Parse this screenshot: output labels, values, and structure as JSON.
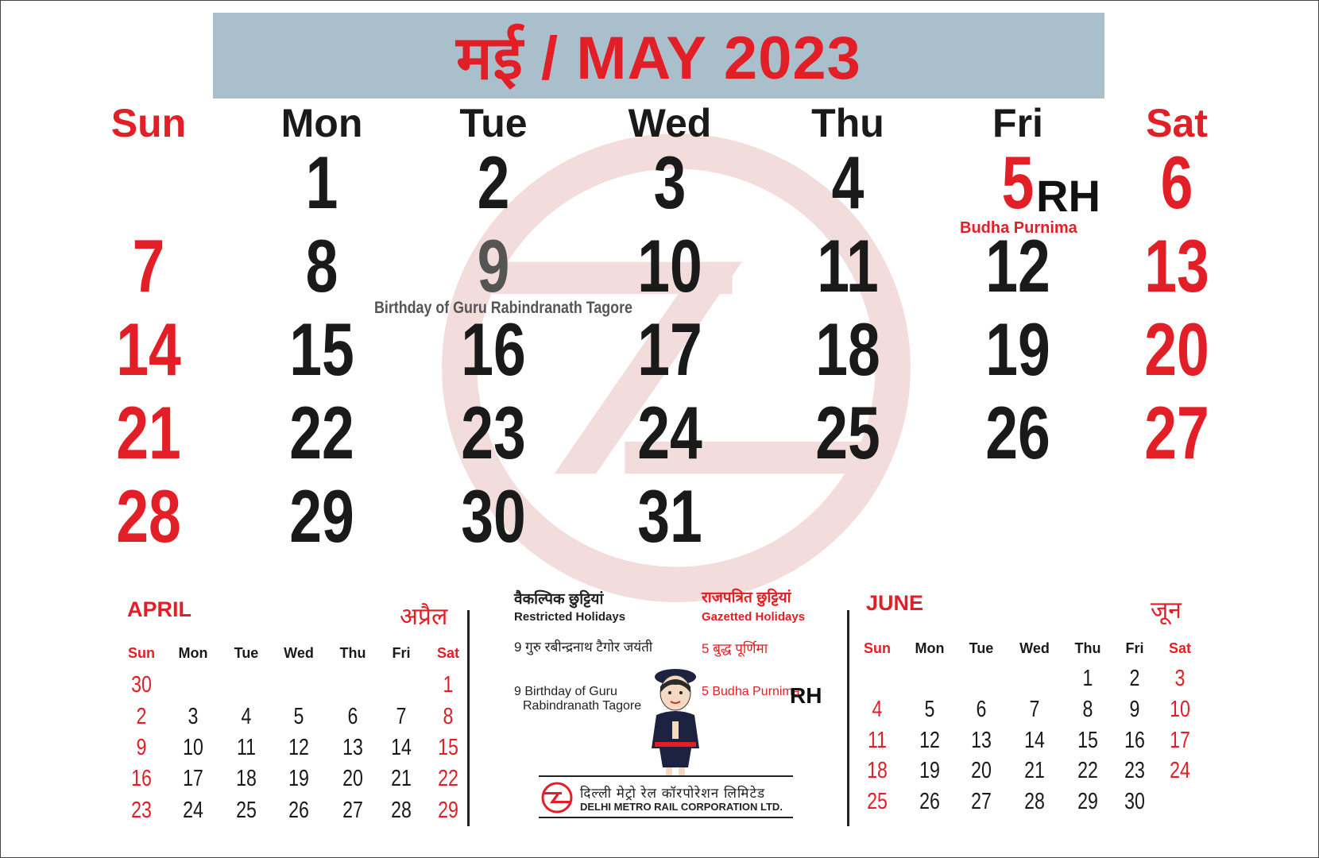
{
  "title": "मई / MAY 2023",
  "weekdays": [
    "Sun",
    "Mon",
    "Tue",
    "Wed",
    "Thu",
    "Fri",
    "Sat"
  ],
  "weeks": [
    [
      "",
      "1",
      "2",
      "3",
      "4",
      "5",
      "6"
    ],
    [
      "7",
      "8",
      "9",
      "10",
      "11",
      "12",
      "13"
    ],
    [
      "14",
      "15",
      "16",
      "17",
      "18",
      "19",
      "20"
    ],
    [
      "21",
      "22",
      "23",
      "24",
      "25",
      "26",
      "27"
    ],
    [
      "28",
      "29",
      "30",
      "31",
      "",
      "",
      ""
    ]
  ],
  "notes": {
    "rh_label": "RH",
    "budha_purnima": "Budha Purnima",
    "tagore_birthday": "Birthday of Guru Rabindranath Tagore"
  },
  "april": {
    "title_en": "APRIL",
    "title_hi": "अप्रैल",
    "weekdays": [
      "Sun",
      "Mon",
      "Tue",
      "Wed",
      "Thu",
      "Fri",
      "Sat"
    ],
    "weeks": [
      [
        "30",
        "",
        "",
        "",
        "",
        "",
        "1"
      ],
      [
        "2",
        "3",
        "4",
        "5",
        "6",
        "7",
        "8"
      ],
      [
        "9",
        "10",
        "11",
        "12",
        "13",
        "14",
        "15"
      ],
      [
        "16",
        "17",
        "18",
        "19",
        "20",
        "21",
        "22"
      ],
      [
        "23",
        "24",
        "25",
        "26",
        "27",
        "28",
        "29"
      ]
    ]
  },
  "june": {
    "title_en": "JUNE",
    "title_hi": "जून",
    "weekdays": [
      "Sun",
      "Mon",
      "Tue",
      "Wed",
      "Thu",
      "Fri",
      "Sat"
    ],
    "weeks": [
      [
        "",
        "",
        "",
        "",
        "1",
        "2",
        "3"
      ],
      [
        "4",
        "5",
        "6",
        "7",
        "8",
        "9",
        "10"
      ],
      [
        "11",
        "12",
        "13",
        "14",
        "15",
        "16",
        "17"
      ],
      [
        "18",
        "19",
        "20",
        "21",
        "22",
        "23",
        "24"
      ],
      [
        "25",
        "26",
        "27",
        "28",
        "29",
        "30",
        ""
      ]
    ]
  },
  "holidays": {
    "restricted_hi": "वैकल्पिक छुट्टियां",
    "restricted_en": "Restricted Holidays",
    "gazetted_hi": "राजपत्रित छुट्टियां",
    "gazetted_en": "Gazetted Holidays",
    "restricted_item_hi": "9 गुरु रबीन्द्रनाथ टैगोर जयंती",
    "restricted_item_en_line1": "9 Birthday of Guru",
    "restricted_item_en_line2": "Rabindranath Tagore",
    "gazetted_item_hi": "5  बुद्ध पूर्णिमा",
    "gazetted_item_en": "5  Budha Purnima",
    "gazetted_rh": "RH"
  },
  "footer": {
    "org_hi": "दिल्ली मेट्रो रेल कॉरपोरेशन लिमिटेड",
    "org_en": "DELHI METRO RAIL CORPORATION LTD."
  },
  "colors": {
    "accent": "#e21f26",
    "banner": "#a9bfcc",
    "text": "#1a1a1a"
  }
}
